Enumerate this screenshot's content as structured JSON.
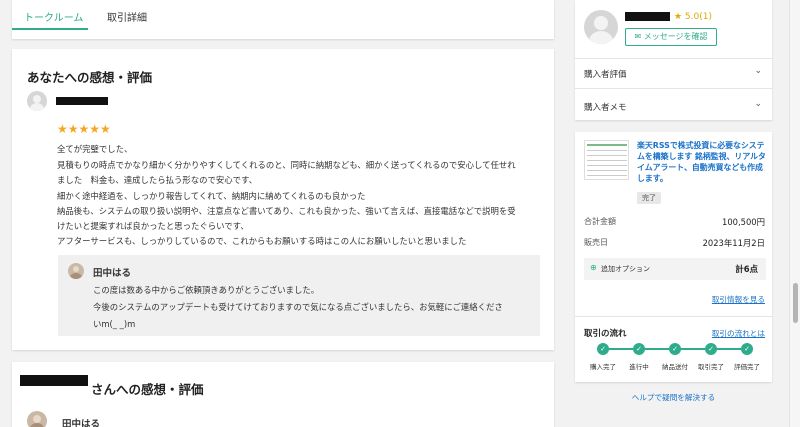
{
  "tabs": [
    {
      "label": "トークルーム",
      "active": true
    },
    {
      "label": "取引詳細",
      "active": false
    }
  ],
  "review": {
    "title": "あなたへの感想・評価",
    "stars": "★★★★★",
    "lines": [
      "全てが完璧でした、",
      "見積もりの時点でかなり細かく分かりやすくしてくれるのと、同時に納期なども、細かく送ってくれるので安心して任せれ",
      "ました　料金も、達成したら払う形なので安心です、",
      "細かく途中経過を、しっかり報告してくれて、納期内に納めてくれるのも良かった",
      "納品後も、システムの取り扱い説明や、注意点など書いてあり、これも良かった、強いて言えば、直接電話などで説明を受",
      "けたいと提案すれば良かったと思ったぐらいです、",
      "アフターサービスも、しっかりしているので、これからもお願いする時はこの人にお願いしたいと思いました"
    ],
    "reply": {
      "name": "田中はる",
      "lines": [
        "この度は数ある中からご依頼頂きありがとうございました。",
        "今後のシステムのアップデートも受けてけておりますので気になる点ございましたら、お気軽にご連絡くださ",
        "いm(_ _)m"
      ]
    }
  },
  "review2": {
    "title_suffix": "さんへの感想・評価",
    "reviewer_name": "田中はる"
  },
  "seller": {
    "rating": "★ 5.0(1)",
    "message_button": "メッセージを確認",
    "menu": [
      {
        "label": "購入者評価"
      },
      {
        "label": "購入者メモ"
      }
    ]
  },
  "transaction": {
    "product_title": "楽天RSSで株式投資に必要なシステムを構築します 銘柄監視、リアルタイムアラート、自動売買なども作成します。",
    "status_badge": "完了",
    "total_label": "合計金額",
    "total_value": "100,500円",
    "date_label": "販売日",
    "date_value": "2023年11月2日",
    "option_label": "追加オプション",
    "option_count": "計6点",
    "info_link": "取引情報を見る",
    "flow_title": "取引の流れ",
    "flow_link": "取引の流れとは",
    "flow_steps": [
      "購入完了",
      "進行中",
      "納品送付",
      "取引完了",
      "評価完了"
    ]
  },
  "help_link": "ヘルプで疑問を解決する",
  "colors": {
    "accent": "#2eac8c",
    "link": "#1a72c9",
    "star": "#f5a623"
  }
}
